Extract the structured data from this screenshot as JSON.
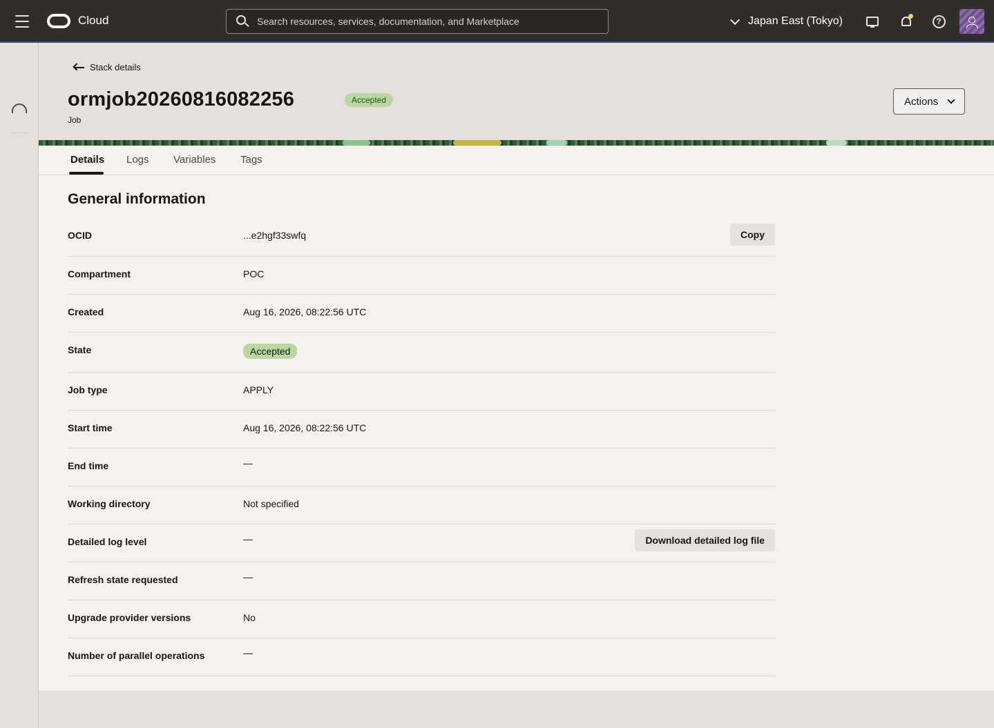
{
  "topbar": {
    "brand": "Cloud",
    "search_placeholder": "Search resources, services, documentation, and Marketplace",
    "region": "Japan East (Tokyo)"
  },
  "header": {
    "back_label": "Stack details",
    "title": "ormjob20260816082256",
    "status": "Accepted",
    "subtitle": "Job",
    "actions_label": "Actions"
  },
  "tabs": [
    {
      "label": "Details",
      "active": true
    },
    {
      "label": "Logs",
      "active": false
    },
    {
      "label": "Variables",
      "active": false
    },
    {
      "label": "Tags",
      "active": false
    }
  ],
  "general": {
    "title": "General information",
    "rows": [
      {
        "label": "OCID",
        "value": "...e2hgf33swfq",
        "button": "Copy"
      },
      {
        "label": "Compartment",
        "value": "POC"
      },
      {
        "label": "Created",
        "value": "Aug 16, 2026, 08:22:56 UTC"
      },
      {
        "label": "State",
        "value": "Accepted"
      },
      {
        "label": "Job type",
        "value": "APPLY"
      },
      {
        "label": "Start time",
        "value": "Aug 16, 2026, 08:22:56 UTC"
      },
      {
        "label": "End time",
        "value": "—"
      },
      {
        "label": "Working directory",
        "value": "Not specified"
      },
      {
        "label": "Detailed log level",
        "value": "—",
        "button": "Download detailed log file"
      },
      {
        "label": "Refresh state requested",
        "value": "—"
      },
      {
        "label": "Upgrade provider versions",
        "value": "No"
      },
      {
        "label": "Number of parallel operations",
        "value": "—"
      }
    ]
  },
  "colors": {
    "topbar": "#312d2a",
    "accepted_badge": "#b8d7a1",
    "panel": "#f4f1ef"
  },
  "icons": [
    "menu-icon",
    "oracle-logo-icon",
    "search-icon",
    "chevron-down-icon",
    "monitor-icon",
    "bell-icon",
    "help-icon",
    "user-icon",
    "cloud-icon",
    "back-arrow-icon"
  ]
}
